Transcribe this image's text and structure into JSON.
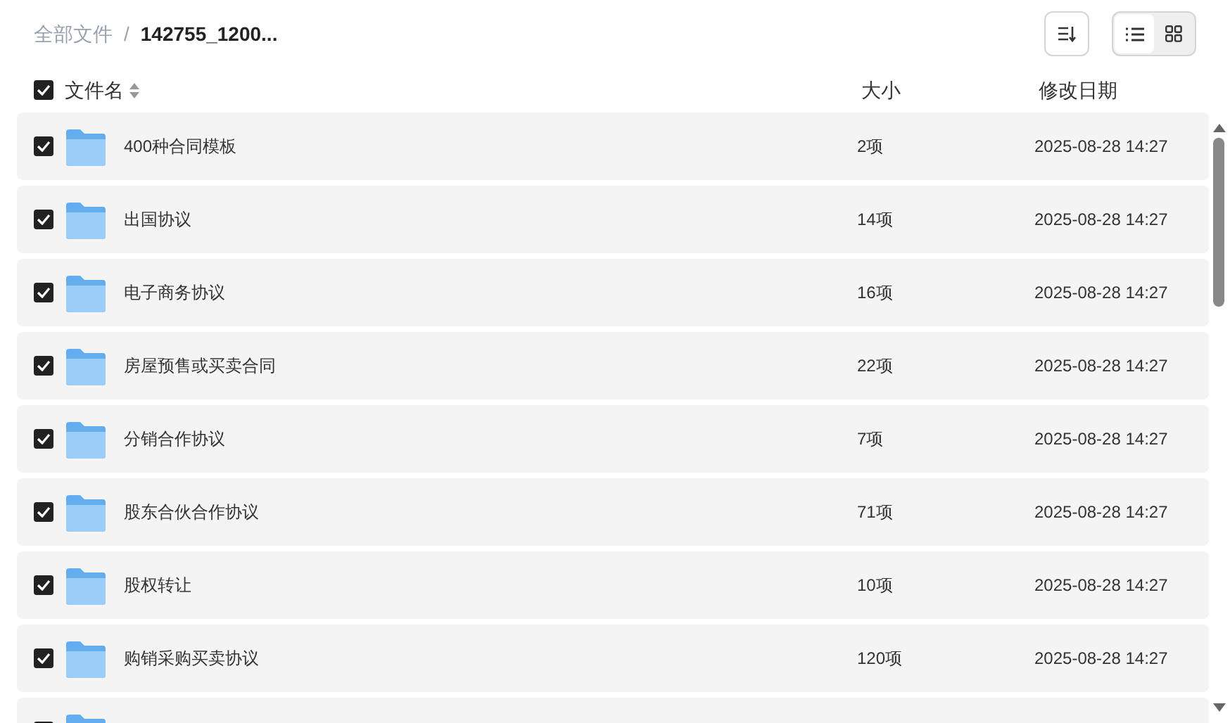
{
  "breadcrumb": [
    {
      "label": "全部文件",
      "current": false
    },
    {
      "separator": "/"
    },
    {
      "label": "142755_1200...",
      "current": true
    }
  ],
  "view_modes": [
    {
      "kind": "list",
      "selected": true
    },
    {
      "kind": "grid",
      "selected": false
    }
  ],
  "select_all": {
    "checked": true
  },
  "columns": {
    "name": "文件名",
    "size": "大小",
    "modified": "修改日期"
  },
  "rows": [
    {
      "name": "400种合同模板",
      "size": "2项",
      "modified": "2025-08-28 14:27",
      "checked": true
    },
    {
      "name": "出国协议",
      "size": "14项",
      "modified": "2025-08-28 14:27",
      "checked": true
    },
    {
      "name": "电子商务协议",
      "size": "16项",
      "modified": "2025-08-28 14:27",
      "checked": true
    },
    {
      "name": "房屋预售或买卖合同",
      "size": "22项",
      "modified": "2025-08-28 14:27",
      "checked": true
    },
    {
      "name": "分销合作协议",
      "size": "7项",
      "modified": "2025-08-28 14:27",
      "checked": true
    },
    {
      "name": "股东合伙合作协议",
      "size": "71项",
      "modified": "2025-08-28 14:27",
      "checked": true
    },
    {
      "name": "股权转让",
      "size": "10项",
      "modified": "2025-08-28 14:27",
      "checked": true
    },
    {
      "name": "购销采购买卖协议",
      "size": "120项",
      "modified": "2025-08-28 14:27",
      "checked": true
    },
    {
      "checked": true
    }
  ]
}
